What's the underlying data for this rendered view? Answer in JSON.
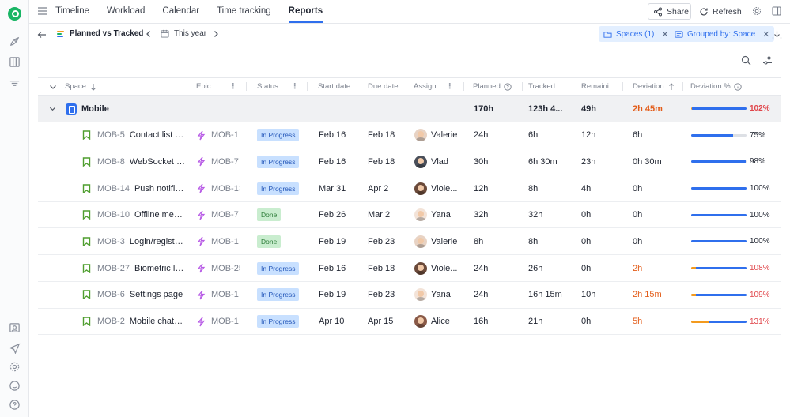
{
  "nav": {
    "tabs": [
      {
        "label": "Timeline"
      },
      {
        "label": "Workload"
      },
      {
        "label": "Calendar"
      },
      {
        "label": "Time tracking"
      },
      {
        "label": "Reports",
        "active": true
      }
    ],
    "share_label": "Share",
    "refresh_label": "Refresh"
  },
  "subbar": {
    "report_name": "Planned vs Tracked",
    "period": "This year",
    "chips": [
      {
        "label": "Spaces (1)"
      },
      {
        "label": "Grouped by: Space"
      }
    ]
  },
  "table": {
    "columns": {
      "space": "Space",
      "epic": "Epic",
      "status": "Status",
      "start": "Start date",
      "due": "Due date",
      "assignee": "Assign...",
      "planned": "Planned",
      "tracked": "Tracked",
      "remaining": "Remaini...",
      "deviation": "Deviation",
      "deviation_pct": "Deviation %"
    },
    "group": {
      "name": "Mobile",
      "planned": "170h",
      "tracked": "123h 4...",
      "remaining": "49h",
      "deviation": "2h 45m",
      "deviation_pct": "102%",
      "deviation_value": 102
    },
    "rows": [
      {
        "key": "MOB-5",
        "name": "Contact list & ...",
        "epic": "MOB-1",
        "status": "In Progress",
        "start": "Feb 16",
        "due": "Feb 18",
        "assignee": "Valerie",
        "planned": "24h",
        "tracked": "6h",
        "remaining": "12h",
        "deviation": "6h",
        "deviation_pct": "75%",
        "deviation_value": 75,
        "warn": false
      },
      {
        "key": "MOB-8",
        "name": "WebSocket co...",
        "epic": "MOB-7",
        "status": "In Progress",
        "start": "Feb 16",
        "due": "Feb 18",
        "assignee": "Vlad",
        "planned": "30h",
        "tracked": "6h 30m",
        "remaining": "23h",
        "deviation": "0h 30m",
        "deviation_pct": "98%",
        "deviation_value": 98,
        "warn": false
      },
      {
        "key": "MOB-14",
        "name": "Push notifica...",
        "epic": "MOB-13",
        "status": "In Progress",
        "start": "Mar 31",
        "due": "Apr 2",
        "assignee": "Viole...",
        "planned": "12h",
        "tracked": "8h",
        "remaining": "4h",
        "deviation": "0h",
        "deviation_pct": "100%",
        "deviation_value": 100,
        "warn": false
      },
      {
        "key": "MOB-10",
        "name": "Offline mess...",
        "epic": "MOB-7",
        "status": "Done",
        "start": "Feb 26",
        "due": "Mar 2",
        "assignee": "Yana",
        "planned": "32h",
        "tracked": "32h",
        "remaining": "0h",
        "deviation": "0h",
        "deviation_pct": "100%",
        "deviation_value": 100,
        "warn": false
      },
      {
        "key": "MOB-3",
        "name": "Login/registra...",
        "epic": "MOB-1",
        "status": "Done",
        "start": "Feb 19",
        "due": "Feb 23",
        "assignee": "Valerie",
        "planned": "8h",
        "tracked": "8h",
        "remaining": "0h",
        "deviation": "0h",
        "deviation_pct": "100%",
        "deviation_value": 100,
        "warn": false
      },
      {
        "key": "MOB-27",
        "name": "Biometric log...",
        "epic": "MOB-25",
        "status": "In Progress",
        "start": "Feb 16",
        "due": "Feb 18",
        "assignee": "Viole...",
        "planned": "24h",
        "tracked": "26h",
        "remaining": "0h",
        "deviation": "2h",
        "deviation_pct": "108%",
        "deviation_value": 108,
        "warn": true
      },
      {
        "key": "MOB-6",
        "name": "Settings page",
        "epic": "MOB-1",
        "status": "In Progress",
        "start": "Feb 19",
        "due": "Feb 23",
        "assignee": "Yana",
        "planned": "24h",
        "tracked": "16h 15m",
        "remaining": "10h",
        "deviation": "2h 15m",
        "deviation_pct": "109%",
        "deviation_value": 109,
        "warn": true
      },
      {
        "key": "MOB-2",
        "name": "Mobile chat UI",
        "epic": "MOB-1",
        "status": "In Progress",
        "start": "Apr 10",
        "due": "Apr 15",
        "assignee": "Alice",
        "planned": "16h",
        "tracked": "21h",
        "remaining": "0h",
        "deviation": "5h",
        "deviation_pct": "131%",
        "deviation_value": 131,
        "warn": true
      }
    ]
  },
  "colors": {
    "accent": "#2f6fed",
    "over_budget": "#f39a1e",
    "warning_text": "#e35d1a",
    "epic": "#b85ce6",
    "story": "#4f9e2f"
  }
}
